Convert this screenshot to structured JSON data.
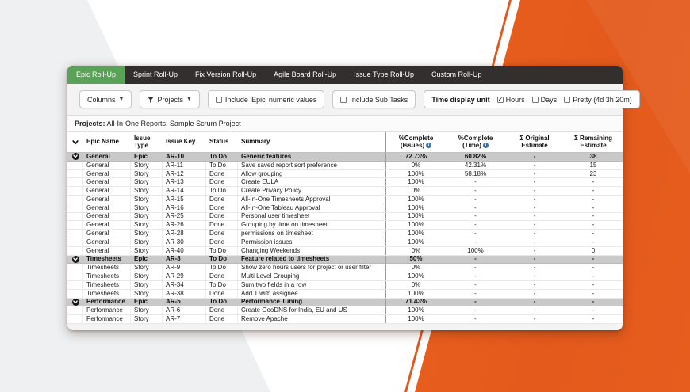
{
  "tabs": [
    {
      "label": "Epic Roll-Up",
      "active": true
    },
    {
      "label": "Sprint Roll-Up",
      "active": false
    },
    {
      "label": "Fix Version Roll-Up",
      "active": false
    },
    {
      "label": "Agile Board Roll-Up",
      "active": false
    },
    {
      "label": "Issue Type Roll-Up",
      "active": false
    },
    {
      "label": "Custom Roll-Up",
      "active": false
    }
  ],
  "toolbar": {
    "columns_label": "Columns",
    "projects_label": "Projects",
    "include_epic_label": "Include 'Epic' numeric values",
    "include_epic_checked": false,
    "include_subtasks_label": "Include Sub Tasks",
    "include_subtasks_checked": false,
    "time_display": {
      "label": "Time display unit",
      "options": [
        {
          "label": "Hours",
          "checked": true
        },
        {
          "label": "Days",
          "checked": false
        },
        {
          "label": "Pretty (4d 3h 20m)",
          "checked": false
        }
      ]
    }
  },
  "projects_bar": {
    "label": "Projects:",
    "value": " All-In-One Reports, Sample Scrum Project"
  },
  "table": {
    "columns": [
      {
        "id": "expander",
        "lines": [],
        "align": "center",
        "icon": "chevron-down"
      },
      {
        "id": "epic-name",
        "lines": [
          "Epic Name"
        ],
        "align": "left"
      },
      {
        "id": "issue-type",
        "lines": [
          "Issue",
          "Type"
        ],
        "align": "left"
      },
      {
        "id": "issue-key",
        "lines": [
          "Issue Key"
        ],
        "align": "left"
      },
      {
        "id": "status",
        "lines": [
          "Status"
        ],
        "align": "left"
      },
      {
        "id": "summary",
        "lines": [
          "Summary"
        ],
        "align": "left"
      },
      {
        "id": "pc-issues",
        "lines": [
          "%Complete",
          "(Issues)"
        ],
        "info": true,
        "align": "center"
      },
      {
        "id": "pc-time",
        "lines": [
          "%Complete",
          "(Time)"
        ],
        "info": true,
        "align": "center"
      },
      {
        "id": "orig-estimate",
        "lines": [
          "Σ Original",
          "Estimate"
        ],
        "align": "center"
      },
      {
        "id": "remain-estimate",
        "lines": [
          "Σ Remaining",
          "Estimate"
        ],
        "align": "center"
      }
    ],
    "rows": [
      {
        "epic": true,
        "name": "General",
        "type": "Epic",
        "key": "AR-10",
        "status": "To Do",
        "summary": "Generic features",
        "pc_issues": "72.73%",
        "pc_time": "60.82%",
        "orig": "-",
        "remain": "38"
      },
      {
        "epic": false,
        "name": "General",
        "type": "Story",
        "key": "AR-11",
        "status": "To Do",
        "summary": "Save saved report sort preference",
        "pc_issues": "0%",
        "pc_time": "42.31%",
        "orig": "-",
        "remain": "15"
      },
      {
        "epic": false,
        "name": "General",
        "type": "Story",
        "key": "AR-12",
        "status": "Done",
        "summary": "Allow grouping",
        "pc_issues": "100%",
        "pc_time": "58.18%",
        "orig": "-",
        "remain": "23"
      },
      {
        "epic": false,
        "name": "General",
        "type": "Story",
        "key": "AR-13",
        "status": "Done",
        "summary": "Create EULA",
        "pc_issues": "100%",
        "pc_time": "-",
        "orig": "-",
        "remain": "-"
      },
      {
        "epic": false,
        "name": "General",
        "type": "Story",
        "key": "AR-14",
        "status": "To Do",
        "summary": "Create Privacy Policy",
        "pc_issues": "0%",
        "pc_time": "-",
        "orig": "-",
        "remain": "-"
      },
      {
        "epic": false,
        "name": "General",
        "type": "Story",
        "key": "AR-15",
        "status": "Done",
        "summary": "All-In-One Timesheets Approval",
        "pc_issues": "100%",
        "pc_time": "-",
        "orig": "-",
        "remain": "-"
      },
      {
        "epic": false,
        "name": "General",
        "type": "Story",
        "key": "AR-16",
        "status": "Done",
        "summary": "All-In-One Tableau Approval",
        "pc_issues": "100%",
        "pc_time": "-",
        "orig": "-",
        "remain": "-"
      },
      {
        "epic": false,
        "name": "General",
        "type": "Story",
        "key": "AR-25",
        "status": "Done",
        "summary": "Personal user timesheet",
        "pc_issues": "100%",
        "pc_time": "-",
        "orig": "-",
        "remain": "-"
      },
      {
        "epic": false,
        "name": "General",
        "type": "Story",
        "key": "AR-26",
        "status": "Done",
        "summary": "Grouping by time on timesheet",
        "pc_issues": "100%",
        "pc_time": "-",
        "orig": "-",
        "remain": "-"
      },
      {
        "epic": false,
        "name": "General",
        "type": "Story",
        "key": "AR-28",
        "status": "Done",
        "summary": "permissions on timesheet",
        "pc_issues": "100%",
        "pc_time": "-",
        "orig": "-",
        "remain": "-"
      },
      {
        "epic": false,
        "name": "General",
        "type": "Story",
        "key": "AR-30",
        "status": "Done",
        "summary": "Permission issues",
        "pc_issues": "100%",
        "pc_time": "-",
        "orig": "-",
        "remain": "-"
      },
      {
        "epic": false,
        "name": "General",
        "type": "Story",
        "key": "AR-40",
        "status": "To Do",
        "summary": "Changing Weekends",
        "pc_issues": "0%",
        "pc_time": "100%",
        "orig": "-",
        "remain": "0"
      },
      {
        "epic": true,
        "name": "Timesheets",
        "type": "Epic",
        "key": "AR-8",
        "status": "To Do",
        "summary": "Feature related to timesheets",
        "pc_issues": "50%",
        "pc_time": "-",
        "orig": "-",
        "remain": "-"
      },
      {
        "epic": false,
        "name": "Timesheets",
        "type": "Story",
        "key": "AR-9",
        "status": "To Do",
        "summary": "Show zero hours users for project or user filter",
        "pc_issues": "0%",
        "pc_time": "-",
        "orig": "-",
        "remain": "-"
      },
      {
        "epic": false,
        "name": "Timesheets",
        "type": "Story",
        "key": "AR-29",
        "status": "Done",
        "summary": "Multi Level Grouping",
        "pc_issues": "100%",
        "pc_time": "-",
        "orig": "-",
        "remain": "-"
      },
      {
        "epic": false,
        "name": "Timesheets",
        "type": "Story",
        "key": "AR-34",
        "status": "To Do",
        "summary": "Sum two fields in a row",
        "pc_issues": "0%",
        "pc_time": "-",
        "orig": "-",
        "remain": "-"
      },
      {
        "epic": false,
        "name": "Timesheets",
        "type": "Story",
        "key": "AR-38",
        "status": "Done",
        "summary": "Add T with assignee",
        "pc_issues": "100%",
        "pc_time": "-",
        "orig": "-",
        "remain": "-"
      },
      {
        "epic": true,
        "name": "Performance",
        "type": "Epic",
        "key": "AR-5",
        "status": "To Do",
        "summary": "Performance Tuning",
        "pc_issues": "71.43%",
        "pc_time": "-",
        "orig": "-",
        "remain": "-"
      },
      {
        "epic": false,
        "name": "Performance",
        "type": "Story",
        "key": "AR-6",
        "status": "Done",
        "summary": "Create GeoDNS for India, EU and US",
        "pc_issues": "100%",
        "pc_time": "-",
        "orig": "-",
        "remain": "-"
      },
      {
        "epic": false,
        "name": "Performance",
        "type": "Story",
        "key": "AR-7",
        "status": "Done",
        "summary": "Remove Apache",
        "pc_issues": "100%",
        "pc_time": "-",
        "orig": "-",
        "remain": "-"
      }
    ]
  },
  "colors": {
    "accent_green": "#5aa257",
    "brand_orange": "#e35a1c",
    "tabbar_dark": "#332f2e",
    "epic_row_gray": "#c9c9c9",
    "info_blue": "#3b73af"
  }
}
